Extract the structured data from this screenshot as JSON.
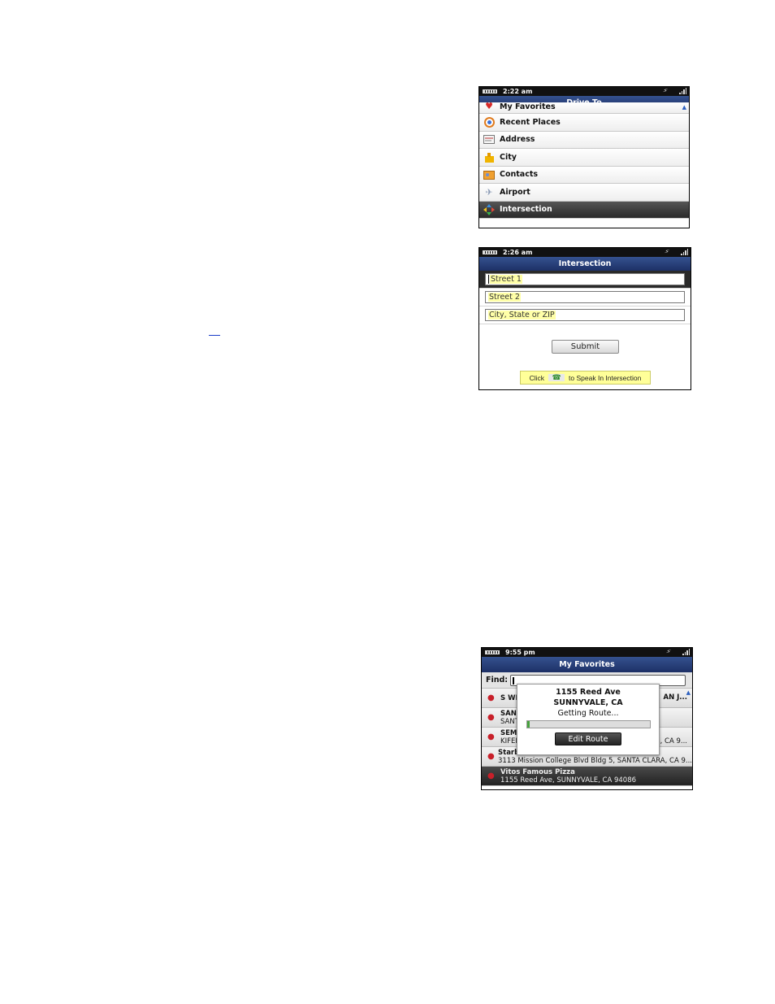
{
  "screen1": {
    "time": "2:22 am",
    "title": "Drive To",
    "items": [
      {
        "label": "My Favorites",
        "icon": "heart-icon"
      },
      {
        "label": "Recent Places",
        "icon": "recent-icon"
      },
      {
        "label": "Address",
        "icon": "address-card-icon"
      },
      {
        "label": "City",
        "icon": "city-icon"
      },
      {
        "label": "Contacts",
        "icon": "contacts-icon"
      },
      {
        "label": "Airport",
        "icon": "airplane-icon"
      },
      {
        "label": "Intersection",
        "icon": "intersection-icon"
      }
    ]
  },
  "screen2": {
    "time": "2:26 am",
    "title": "Intersection",
    "fields": [
      {
        "placeholder": "Street 1"
      },
      {
        "placeholder": "Street 2"
      },
      {
        "placeholder": "City, State or ZIP"
      }
    ],
    "submit_label": "Submit",
    "hint_prefix": "Click",
    "hint_suffix": "to Speak In Intersection"
  },
  "screen3": {
    "time": "9:55 pm",
    "title": "My Favorites",
    "find_label": "Find:",
    "rows": [
      {
        "line1": "S WI",
        "line2": "",
        "right": "AN J..."
      },
      {
        "line1": "SAN",
        "line2": "SANT",
        "right": ""
      },
      {
        "line1": "SEM",
        "line2": "KIFEI",
        "right": ", CA 9..."
      },
      {
        "line1": "Starbucks Coffee",
        "line2": "3113 Mission College Blvd Bldg 5, SANTA CLARA, CA 9...",
        "right": ""
      },
      {
        "line1": "Vitos Famous Pizza",
        "line2": "1155 Reed Ave, SUNNYVALE, CA 94086",
        "right": ""
      }
    ],
    "dialog": {
      "line1": "1155 Reed Ave",
      "line2": "SUNNYVALE, CA",
      "status": "Getting Route...",
      "progress": 0.02,
      "button": "Edit Route"
    }
  }
}
